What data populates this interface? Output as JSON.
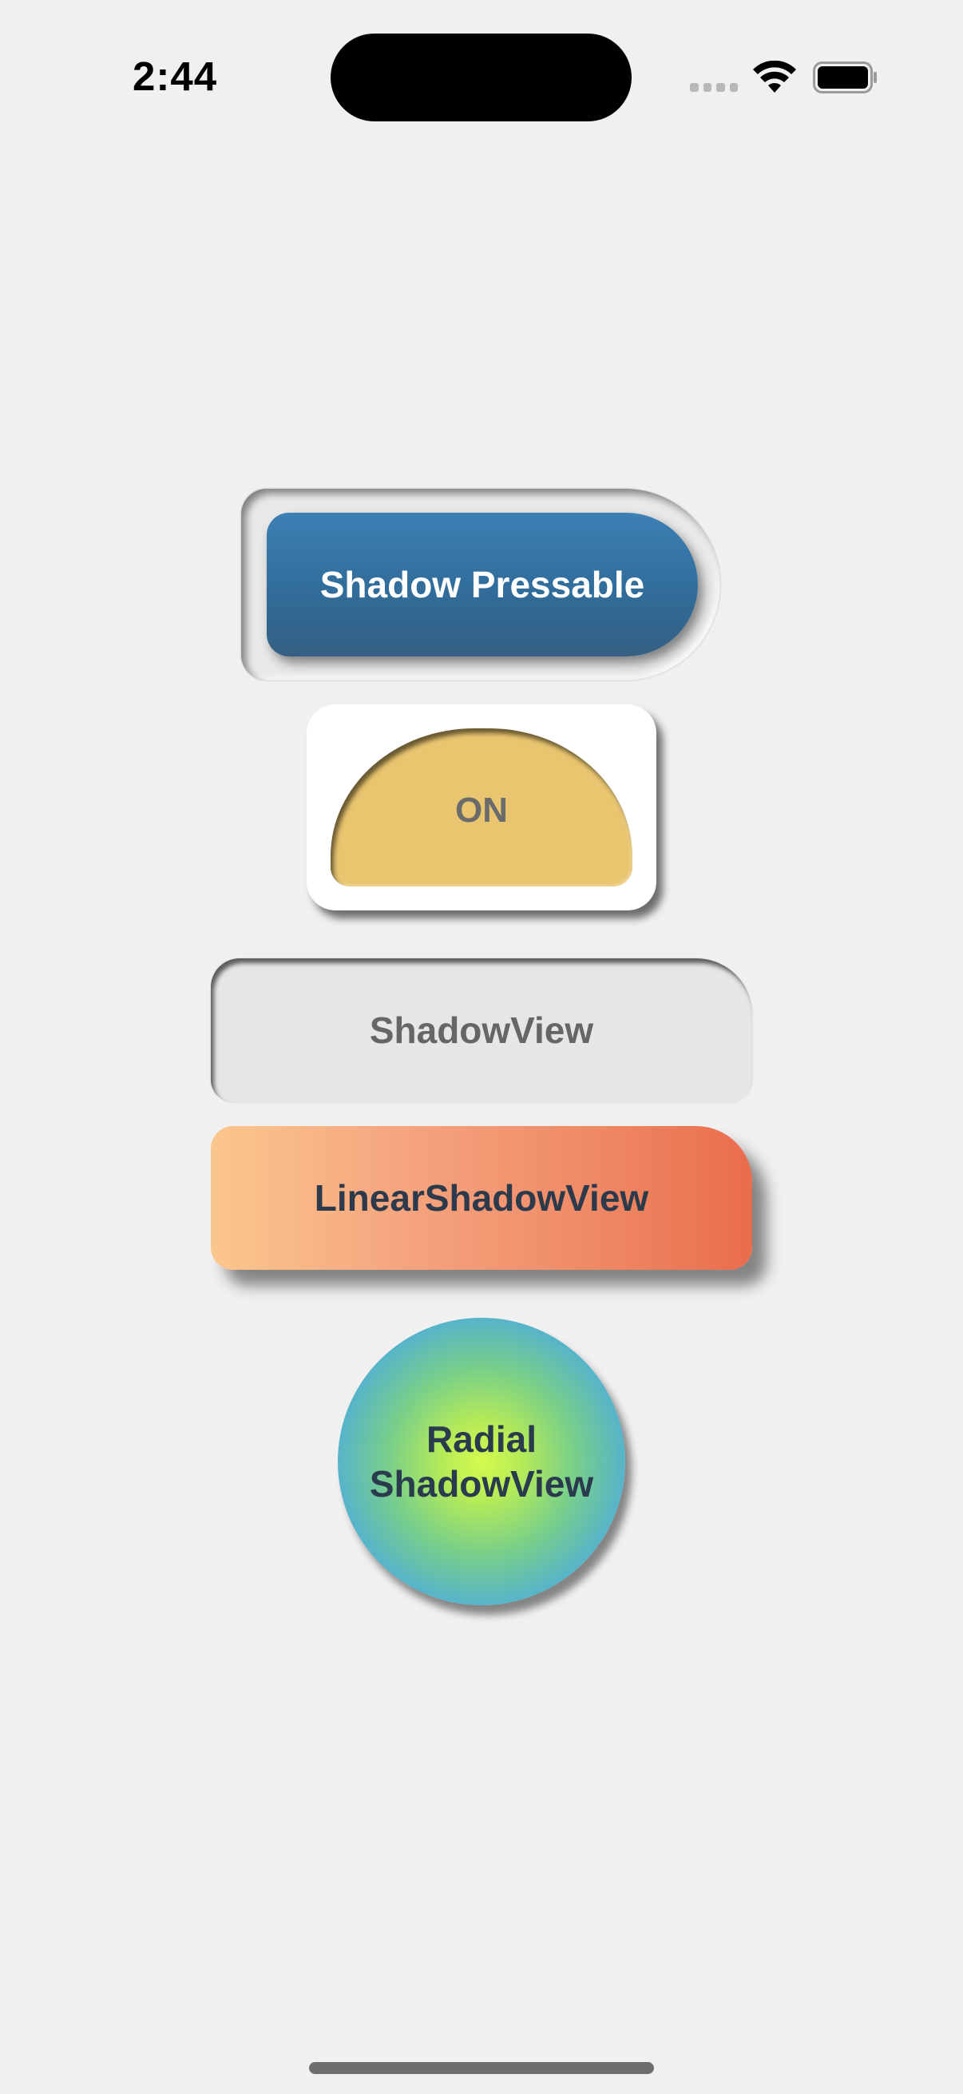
{
  "status_bar": {
    "time": "2:44"
  },
  "components": {
    "shadow_pressable": {
      "label": "Shadow Pressable",
      "color": "#3575a7"
    },
    "toggle": {
      "label": "ON",
      "color": "#e9c56f"
    },
    "shadow_view": {
      "label": "ShadowView"
    },
    "linear_shadow_view": {
      "label": "LinearShadowView",
      "gradient": [
        "#fbc78d",
        "#e96d4c"
      ]
    },
    "radial_shadow_view": {
      "label_line1": "Radial",
      "label_line2": "ShadowView",
      "gradient": [
        "#d5fb4d",
        "#459fe0"
      ]
    }
  },
  "icons": {
    "signal": "cellular-signal-icon",
    "wifi": "wifi-icon",
    "battery": "battery-icon"
  }
}
